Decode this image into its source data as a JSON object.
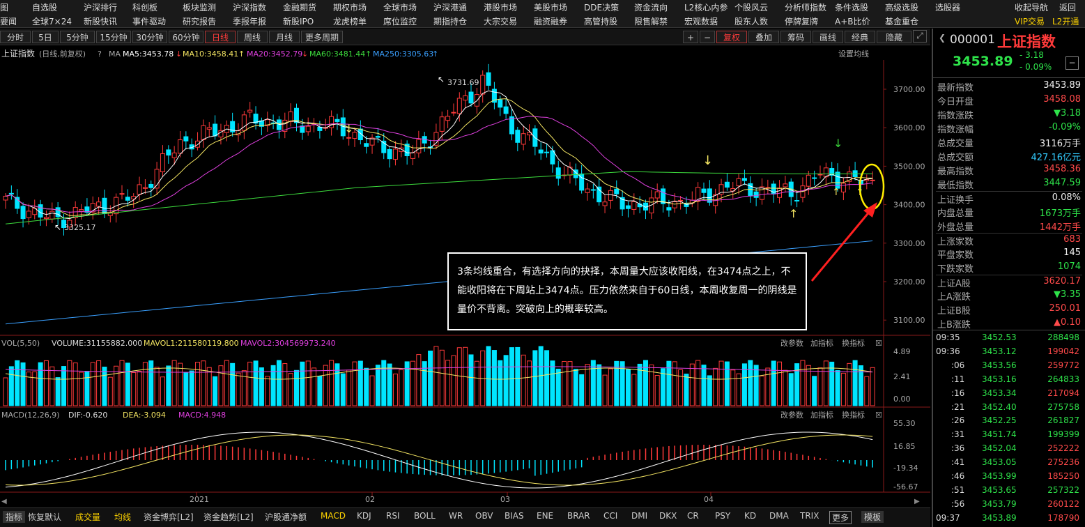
{
  "menu": {
    "row1": [
      "图",
      "自选股",
      "沪深排行",
      "科创板",
      "板块监测",
      "沪深指数",
      "金融期货",
      "期权市场",
      "全球市场",
      "沪深港通",
      "港股市场",
      "美股市场",
      "DDE决策",
      "资金流向",
      "L2核心内参",
      "个股风云",
      "分析师指数",
      "条件选股",
      "高级选股",
      "选股器",
      "收起导航",
      "返回"
    ],
    "row2": [
      "要闻",
      "全球7×24",
      "新股快讯",
      "事件驱动",
      "研究报告",
      "季报年报",
      "新股IPO",
      "龙虎榜单",
      "席位监控",
      "期指持仓",
      "大宗交易",
      "融资融券",
      "高管持股",
      "限售解禁",
      "宏观数据",
      "股东人数",
      "停牌复牌",
      "A+B比价",
      "基金重仓"
    ],
    "vip": "VIP交易",
    "l2": "L2开通"
  },
  "toolbar": {
    "periods": [
      "分时",
      "5日",
      "5分钟",
      "15分钟",
      "30分钟",
      "60分钟",
      "日线",
      "周线",
      "月线",
      "更多周期"
    ],
    "active_period": "日线",
    "right": [
      "+",
      "−",
      "复权",
      "叠加",
      "筹码",
      "画线",
      "经典",
      "隐藏"
    ]
  },
  "main_legend": {
    "name": "上证指数",
    "mode": "(日线,前复权)",
    "ma_label": "MA",
    "ma5": "MA5:3453.78",
    "ma10": "MA10:3458.41",
    "ma20": "MA20:3452.79",
    "ma60": "MA60:3481.44",
    "ma250": "MA250:3305.63",
    "settings": "设置均线"
  },
  "vol_legend": {
    "name": "VOL(5,50)",
    "volume": "VOLUME:31155882.000",
    "mavol1": "MAVOL1:211580119.800",
    "mavol2": "MAVOL2:304569973.240"
  },
  "macd_legend": {
    "name": "MACD(12,26,9)",
    "dif": "DIF:-0.620",
    "dea": "DEA:-3.094",
    "macd": "MACD:4.948"
  },
  "panel_buttons": [
    "改参数",
    "加指标",
    "换指标"
  ],
  "axis": {
    "price_ticks": [
      "3700.00",
      "3600.00",
      "3500.00",
      "3400.00",
      "3300.00",
      "3200.00",
      "3100.00"
    ],
    "vol_ticks": [
      "4.89",
      "2.41",
      "0.00"
    ],
    "macd_ticks": [
      "55.30",
      "16.85",
      "-19.34",
      "-56.67"
    ],
    "dates": [
      "2021",
      "02",
      "03",
      "04"
    ]
  },
  "annotations": {
    "high_label": "3731.69",
    "low_label": "3325.17",
    "note": "3条均线重合，有选择方向的抉择，本周量大应该收阳线，在3474点之上，不能收阳将在下周站上3474点。压力依然来自于60日线，本周收复周一的阴线是量价不背离。突破向上的概率较高。"
  },
  "sidebar": {
    "code": "000001",
    "name": "上证指数",
    "price": "3453.89",
    "change": "- 3.18",
    "change_pct": "- 0.09%",
    "stats": [
      {
        "k": "最新指数",
        "v": "3453.89",
        "c": "white"
      },
      {
        "k": "今日开盘",
        "v": "3458.08",
        "c": "red"
      },
      {
        "k": "指数涨跌",
        "v": "▼3.18",
        "c": "green"
      },
      {
        "k": "指数涨幅",
        "v": "-0.09%",
        "c": "green"
      },
      {
        "k": "总成交量",
        "v": "3116万手",
        "c": "white"
      },
      {
        "k": "总成交额",
        "v": "427.16亿元",
        "c": "cyan"
      },
      {
        "k": "最高指数",
        "v": "3458.36",
        "c": "red"
      },
      {
        "k": "最低指数",
        "v": "3447.59",
        "c": "green"
      },
      {
        "k": "上证换手",
        "v": "0.08%",
        "c": "white"
      },
      {
        "k": "内盘总量",
        "v": "1673万手",
        "c": "green"
      },
      {
        "k": "外盘总量",
        "v": "1442万手",
        "c": "red"
      },
      {
        "k": "上涨家数",
        "v": "683",
        "c": "red"
      },
      {
        "k": "平盘家数",
        "v": "145",
        "c": "white"
      },
      {
        "k": "下跌家数",
        "v": "1074",
        "c": "green"
      },
      {
        "k": "上证A股",
        "v": "3620.17",
        "c": "red"
      },
      {
        "k": "上A涨跌",
        "v": "▼3.35",
        "c": "green"
      },
      {
        "k": "上证B股",
        "v": "250.01",
        "c": "red"
      },
      {
        "k": "上B涨跌",
        "v": "▲0.10",
        "c": "red"
      }
    ],
    "ticks": [
      {
        "t": "09:35",
        "p": "3452.53",
        "v": "288498",
        "vc": "green"
      },
      {
        "t": "09:36",
        "p": "3453.12",
        "v": "199042",
        "vc": "red"
      },
      {
        "t": ":06",
        "p": "3453.56",
        "v": "259772",
        "vc": "red"
      },
      {
        "t": ":11",
        "p": "3453.16",
        "v": "264833",
        "vc": "green"
      },
      {
        "t": ":16",
        "p": "3453.34",
        "v": "217094",
        "vc": "red"
      },
      {
        "t": ":21",
        "p": "3452.40",
        "v": "275758",
        "vc": "green"
      },
      {
        "t": ":26",
        "p": "3452.25",
        "v": "261827",
        "vc": "green"
      },
      {
        "t": ":31",
        "p": "3451.74",
        "v": "199399",
        "vc": "green"
      },
      {
        "t": ":36",
        "p": "3452.04",
        "v": "252222",
        "vc": "red"
      },
      {
        "t": ":41",
        "p": "3453.05",
        "v": "275236",
        "vc": "red"
      },
      {
        "t": ":46",
        "p": "3453.99",
        "v": "185250",
        "vc": "red"
      },
      {
        "t": ":51",
        "p": "3453.65",
        "v": "257322",
        "vc": "green"
      },
      {
        "t": ":56",
        "p": "3453.79",
        "v": "260122",
        "vc": "red"
      },
      {
        "t": "09:37",
        "p": "3453.89",
        "v": "178790",
        "vc": "red"
      }
    ]
  },
  "bottom": {
    "tabs": [
      "指标",
      "恢复默认",
      "成交量",
      "均线",
      "资金博弈[L2]",
      "资金趋势[L2]",
      "沪股通净额",
      "MACD",
      "KDJ",
      "RSI",
      "BOLL",
      "WR",
      "OBV",
      "BIAS",
      "ENE",
      "BRAR",
      "CCI",
      "DMI",
      "DKX",
      "CR",
      "PSY",
      "KD",
      "DMA",
      "TRIX",
      "更多",
      "模板"
    ],
    "selected": [
      "成交量",
      "均线",
      "MACD"
    ]
  },
  "colors": {
    "up": "#ff3a3a",
    "down": "#00e5ff",
    "ma5": "#ffffff",
    "ma10": "#f5e663",
    "ma20": "#e040e0",
    "ma60": "#3ddc3d",
    "ma250": "#3aa0ff"
  }
}
